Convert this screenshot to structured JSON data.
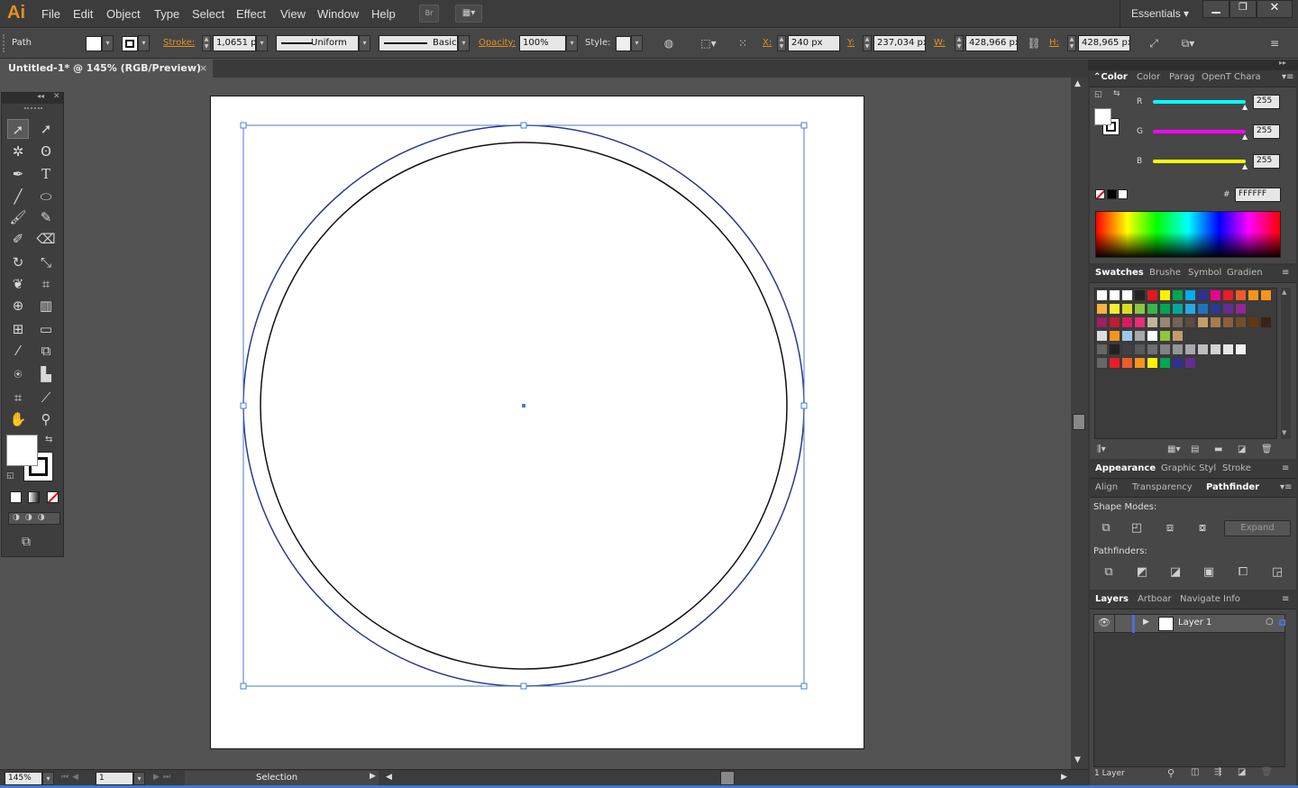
{
  "app": {
    "logo": "Ai"
  },
  "menu": {
    "items": [
      "File",
      "Edit",
      "Object",
      "Type",
      "Select",
      "Effect",
      "View",
      "Window",
      "Help"
    ],
    "workspace": "Essentials"
  },
  "control": {
    "object_type": "Path",
    "stroke_label": "Stroke:",
    "stroke_value": "1,0651 p",
    "stroke_profile": "Uniform",
    "brush": "Basic",
    "opacity_label": "Opacity:",
    "opacity_value": "100%",
    "style_label": "Style:",
    "x_label": "X:",
    "x_value": "240 px",
    "y_label": "Y:",
    "y_value": "237,034 px",
    "w_label": "W:",
    "w_value": "428,966 px",
    "h_label": "H:",
    "h_value": "428,965 px"
  },
  "document": {
    "tab_title": "Untitled-1* @ 145% (RGB/Preview)",
    "close": "×"
  },
  "status": {
    "zoom": "145%",
    "artboard": "1",
    "tool": "Selection"
  },
  "color_panel": {
    "tabs": [
      "Color",
      "Color",
      "Parag",
      "OpenT",
      "Chara"
    ],
    "r_label": "R",
    "r_value": "255",
    "g_label": "G",
    "g_value": "255",
    "b_label": "B",
    "b_value": "255",
    "hex_symbol": "#",
    "hex_value": "FFFFFF"
  },
  "swatches_panel": {
    "tabs": [
      "Swatches",
      "Brushe",
      "Symbol",
      "Gradien"
    ],
    "rows": [
      [
        "#ffffff",
        "#ffffff",
        "#ffffff",
        "#222222",
        "#e8161e",
        "#fff200",
        "#00a651",
        "#00aeef",
        "#2e3192",
        "#ec008c",
        "#ed1c24",
        "#f15a29",
        "#f7941d",
        "#f7941d"
      ],
      [
        "#fbb040",
        "#f9ed32",
        "#d7df23",
        "#8dc63f",
        "#39b54a",
        "#00a651",
        "#00a99d",
        "#27aae1",
        "#1c75bc",
        "#2b3990",
        "#662d91",
        "#92278f"
      ],
      [
        "#9e1f63",
        "#be1e2d",
        "#da1c5c",
        "#ee2a7b",
        "#c2b59b",
        "#998675",
        "#736357",
        "#594a42",
        "#c69c6d",
        "#a97c50",
        "#8b5e3c",
        "#754c29",
        "#603913",
        "#3c2415"
      ],
      [
        "#dddddd",
        "#f7941d",
        "#9ccae8",
        "#a7a9ac",
        "#ffffff",
        "#8dc63f",
        "#c49a6c"
      ],
      [
        "#666666",
        "#222222",
        "#414042",
        "#58595b",
        "#6d6e71",
        "#808285",
        "#939598",
        "#a7a9ac",
        "#bcbec0",
        "#d1d3d4",
        "#e6e7e8",
        "#f1f2f2"
      ],
      [
        "#666666",
        "#ed1c24",
        "#f15a29",
        "#f7941d",
        "#fff200",
        "#00a651",
        "#2e3192",
        "#662d91"
      ]
    ]
  },
  "appearance_tabs": [
    "Appearance",
    "Graphic Styl",
    "Stroke"
  ],
  "pathfinder_panel": {
    "tabs": [
      "Align",
      "Transparency",
      "Pathfinder"
    ],
    "shape_modes_label": "Shape Modes:",
    "expand_label": "Expand",
    "pathfinders_label": "Pathfinders:"
  },
  "layers_panel": {
    "tabs": [
      "Layers",
      "Artboar",
      "Navigate",
      "Info"
    ],
    "layer_name": "Layer 1",
    "count": "1 Layer"
  },
  "icons": {
    "eye": "eye-icon",
    "disclosure": "triangle-right-icon"
  }
}
